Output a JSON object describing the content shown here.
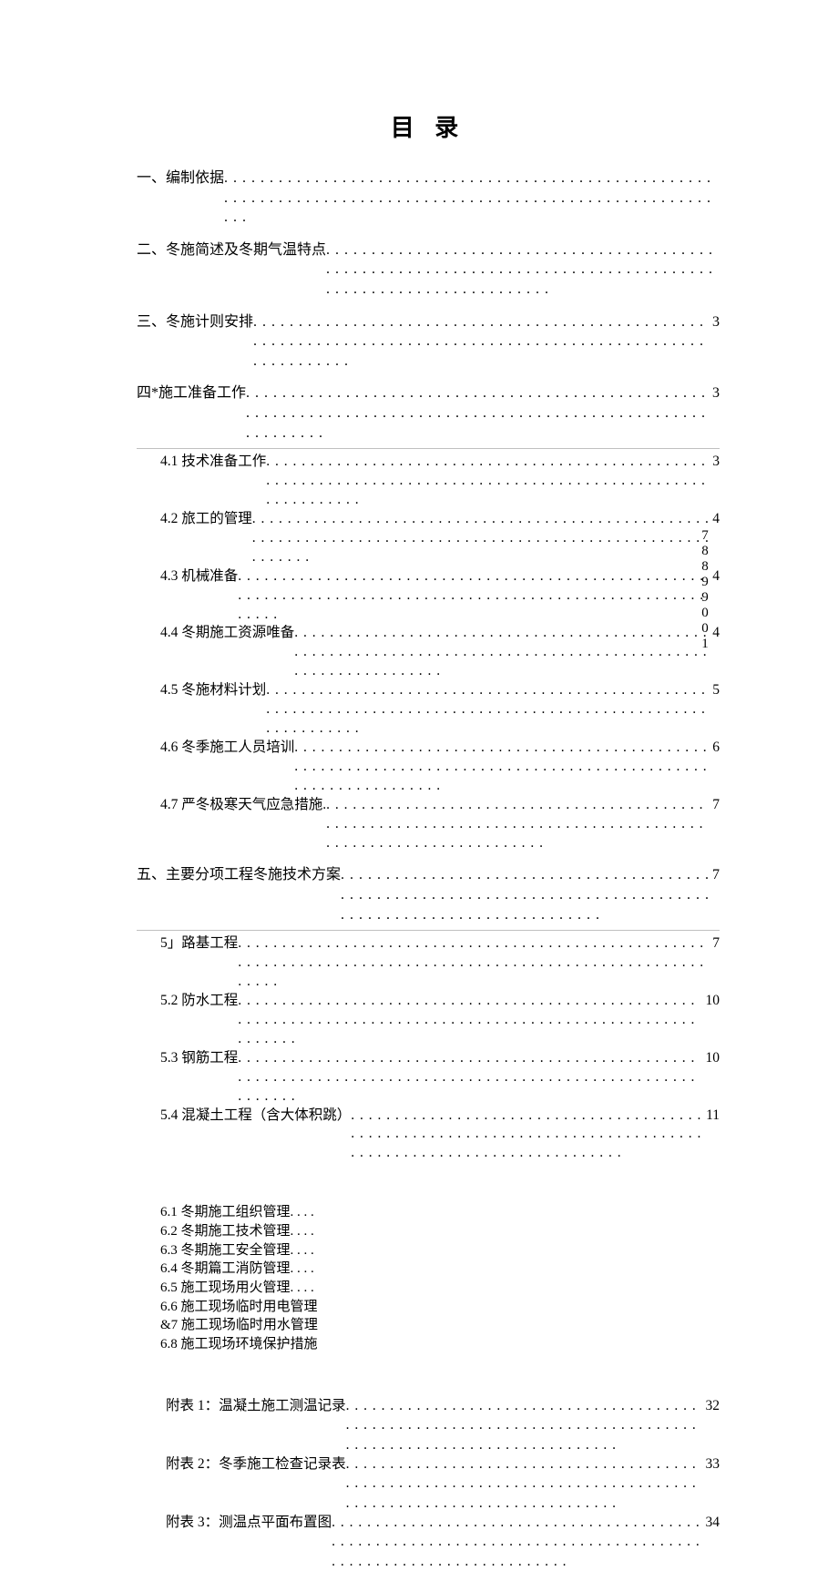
{
  "title": "目 录",
  "dots": ". . . . . . . . . . . . . . . . . . . . . . . . . . . . . . . . . . . . . . . . . . . . . . . . . . . . . . . . . . . . . . . . . . . . . . . . . . . . . . . . . . . . . . . . . . . . . . . . . . . . . . . . . . . . . . .",
  "sec1": {
    "label": "一、编制依据",
    "page": ""
  },
  "sec2": {
    "label": "二、冬施简述及冬期气温特点",
    "page": ""
  },
  "sec3": {
    "label": "三、冬施计则安排",
    "page": "3"
  },
  "sec4": {
    "label": "四*施工准备工作",
    "page": "3"
  },
  "s4": {
    "a": {
      "label": "4.1 技术准备工作",
      "page": "3"
    },
    "b": {
      "label": "4.2 旅工的管理",
      "page": "4"
    },
    "c": {
      "label": "4.3 机械准备",
      "page": "4"
    },
    "d": {
      "label": "4.4 冬期施工资源唯备",
      "page": "4"
    },
    "e": {
      "label": "4.5 冬施材料计划",
      "page": "5"
    },
    "f": {
      "label": "4.6 冬季施工人员培训",
      "page": "6"
    },
    "g": {
      "label": "4.7 严冬极寒天气应急措施.",
      "page": "7"
    }
  },
  "sec5": {
    "label": "五、主要分项工程冬施技术方案",
    "page": "7"
  },
  "s5": {
    "a": {
      "label": "5」路基工程",
      "page": "7"
    },
    "b": {
      "label": "5.2 防水工程",
      "page": "10"
    },
    "c": {
      "label": "5.3 钢筋工程",
      "page": "10"
    },
    "d": {
      "label": "5.4 混凝土工程（含大体积跳）",
      "page": "11"
    }
  },
  "s6": {
    "a": "6.1 冬期施工组织管理. . . .",
    "b": "6.2 冬期施工技术管理. . . .",
    "c": "6.3 冬期施工安全管理. . . .",
    "d": "6.4 冬期篇工消防管理. . . .",
    "e": "6.5 施工现场用火管理. . . .",
    "f": "6.6 施工现场临时用电管理",
    "g": "&7 施工现场临时用水管理",
    "h": "6.8 施工现场环境保护措施"
  },
  "vnum": "78899001",
  "app": {
    "a": {
      "label": "附表 1：温凝土施工测温记录",
      "page": "32"
    },
    "b": {
      "label": "附表 2：冬季施工检查记录表",
      "page": "33"
    },
    "c": {
      "label": "附表 3：测温点平面布置图",
      "page": "34"
    }
  }
}
